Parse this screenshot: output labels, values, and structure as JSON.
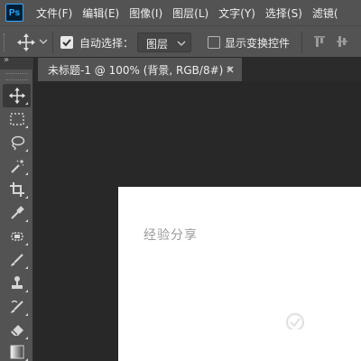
{
  "app": {
    "logo": "Ps",
    "accent_color": "#31a8ff",
    "menus": [
      "文件(F)",
      "编辑(E)",
      "图像(I)",
      "图层(L)",
      "文字(Y)",
      "选择(S)",
      "滤镜("
    ]
  },
  "options_bar": {
    "tool_icon": "move-icon",
    "auto_select_checked": true,
    "auto_select_label": "自动选择：",
    "auto_select_target": "图层",
    "show_transform_checked": false,
    "show_transform_label": "显示变换控件"
  },
  "toolbar": {
    "collapse_glyph": "»",
    "tools": [
      {
        "name": "move-tool",
        "icon": "move-icon",
        "active": true
      },
      {
        "name": "rectangular-marquee-tool",
        "icon": "marquee-icon"
      },
      {
        "name": "lasso-tool",
        "icon": "lasso-icon"
      },
      {
        "name": "magic-wand-tool",
        "icon": "magic-wand-icon"
      },
      {
        "name": "crop-tool",
        "icon": "crop-icon"
      },
      {
        "name": "eyedropper-tool",
        "icon": "eyedropper-icon"
      },
      {
        "name": "healing-brush-tool",
        "icon": "healing-icon"
      },
      {
        "name": "brush-tool",
        "icon": "brush-icon"
      },
      {
        "name": "clone-stamp-tool",
        "icon": "stamp-icon"
      },
      {
        "name": "history-brush-tool",
        "icon": "history-brush-icon"
      },
      {
        "name": "eraser-tool",
        "icon": "eraser-icon"
      },
      {
        "name": "gradient-tool",
        "icon": "gradient-icon"
      }
    ]
  },
  "document": {
    "tab_title": "未标题-1 @ 100% (背景, RGB/8#) *",
    "close_glyph": "×",
    "canvas_color": "#ffffff"
  },
  "watermark": {
    "text": "经验分享"
  }
}
